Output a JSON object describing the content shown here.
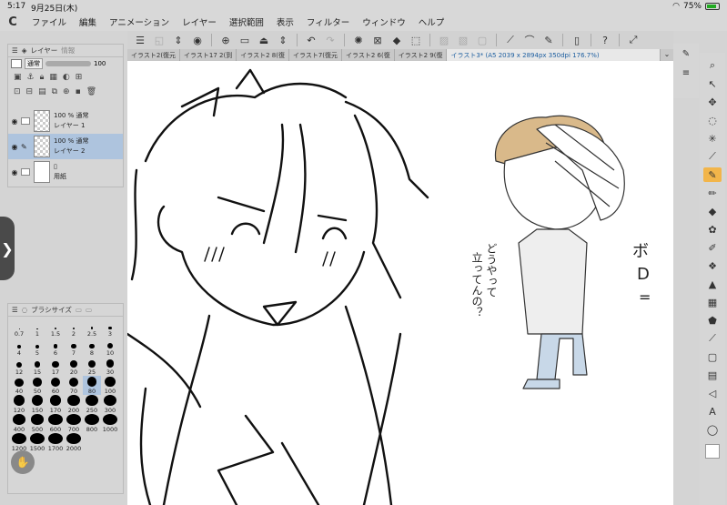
{
  "status": {
    "time": "5:17",
    "date": "9月25日(木)",
    "wifi_icon": "wifi-icon",
    "battery": "75%"
  },
  "menu": {
    "logo": "C",
    "items": [
      "ファイル",
      "編集",
      "アニメーション",
      "レイヤー",
      "選択範囲",
      "表示",
      "フィルター",
      "ウィンドウ",
      "ヘルプ"
    ]
  },
  "tabs": {
    "items": [
      "イラスト2(復元",
      "イラスト17 2(到",
      "イラスト2 8(復",
      "イラスト7(復元",
      "イラスト2 6(復",
      "イラスト2 9(復"
    ],
    "active": "イラスト3* (A5 2039 x 2894px 350dpi 176.7%)"
  },
  "layer_panel": {
    "tab_layer": "レイヤー",
    "tab_other": "情報",
    "blend_mode": "通常",
    "opacity": "100",
    "layers": [
      {
        "opacity": "100 %",
        "mode": "通常",
        "name": "レイヤー 1",
        "selected": false,
        "thumb": "transparent"
      },
      {
        "opacity": "100 %",
        "mode": "通常",
        "name": "レイヤー 2",
        "selected": true,
        "thumb": "transparent"
      },
      {
        "name": "用紙",
        "selected": false,
        "thumb": "white"
      }
    ]
  },
  "brush_panel": {
    "title": "ブラシサイズ",
    "sizes": [
      "0.7",
      "1",
      "1.5",
      "2",
      "2.5",
      "3",
      "4",
      "5",
      "6",
      "7",
      "8",
      "10",
      "12",
      "15",
      "17",
      "20",
      "25",
      "30",
      "40",
      "50",
      "60",
      "70",
      "80",
      "100",
      "120",
      "150",
      "170",
      "200",
      "250",
      "300",
      "400",
      "500",
      "600",
      "700",
      "800",
      "1000",
      "1200",
      "1500",
      "1700",
      "2000"
    ],
    "selected": "80"
  },
  "drawing_text": {
    "vertical1": "どうやって",
    "vertical2": "立ってんの？",
    "bo": "ボ",
    "d": "D",
    "dashes": "="
  },
  "colors": {
    "active_tool": "#f2b54a",
    "selected_layer": "#aec4de",
    "active_tab_text": "#1e5fa0",
    "hair_tan": "#d9b98a",
    "pants_blue": "#c8d8e8",
    "shirt_gray": "#eeeeee"
  }
}
